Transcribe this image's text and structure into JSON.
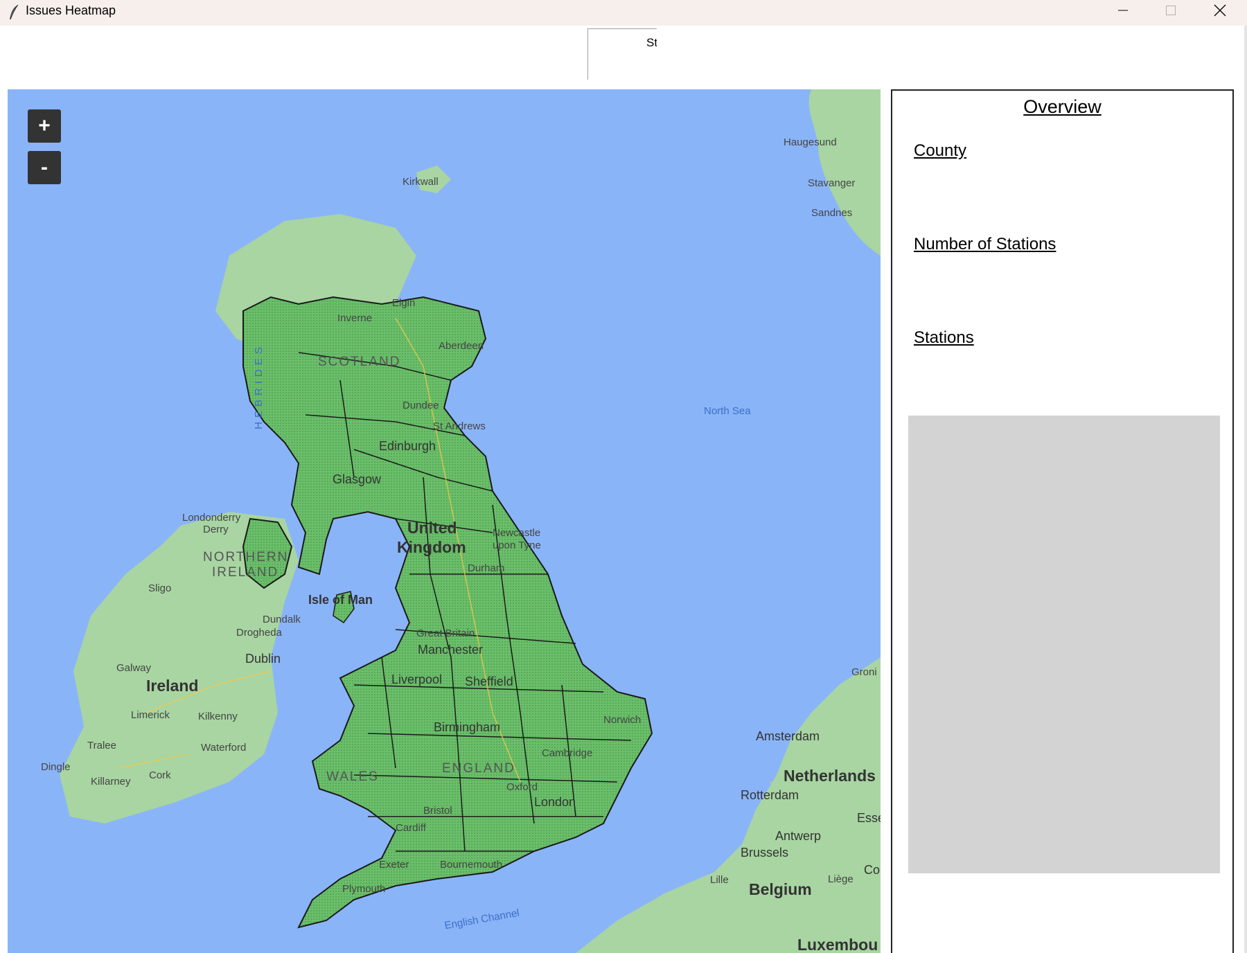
{
  "window": {
    "title": "Issues Heatmap",
    "app_icon": "feather-icon",
    "controls": [
      "minimize-icon",
      "maximize-icon",
      "close-icon"
    ]
  },
  "toolbar": {
    "selector_label": "St"
  },
  "map": {
    "zoom_in_label": "+",
    "zoom_out_label": "-",
    "colors": {
      "water": "#8ab4f8",
      "land": "#a8d5a2",
      "uk_fill": "#6bbf6b",
      "boundary": "#1a1a1a",
      "road": "#f2c84b"
    },
    "labels": {
      "haugesund": "Haugesund",
      "stavanger": "Stavanger",
      "sandnes": "Sandnes",
      "kirkwall": "Kirkwall",
      "elgin": "Elgin",
      "inverness": "Inverne",
      "aberdeen": "Aberdeen",
      "scotland": "SCOTLAND",
      "hebrides": "HEBRIDES",
      "dundee": "Dundee",
      "st_andrews": "St Andrews",
      "edinburgh": "Edinburgh",
      "glasgow": "Glasgow",
      "north_sea": "North Sea",
      "londonderry": "Londonderry",
      "derry": "Derry",
      "northern_ireland_1": "NORTHERN",
      "northern_ireland_2": "IRELAND",
      "united": "United",
      "kingdom": "Kingdom",
      "newcastle_1": "Newcastle",
      "newcastle_2": "upon Tyne",
      "durham": "Durham",
      "sligo": "Sligo",
      "isle_of_man": "Isle of Man",
      "dundalk": "Dundalk",
      "drogheda": "Drogheda",
      "dublin": "Dublin",
      "galway": "Galway",
      "ireland": "Ireland",
      "great_britain": "Great Britain",
      "manchester": "Manchester",
      "liverpool": "Liverpool",
      "sheffield": "Sheffield",
      "limerick": "Limerick",
      "kilkenny": "Kilkenny",
      "groningen": "Groni",
      "norwich": "Norwich",
      "birmingham": "Birmingham",
      "tralee": "Tralee",
      "waterford": "Waterford",
      "cambridge": "Cambridge",
      "amsterdam": "Amsterdam",
      "dingle": "Dingle",
      "killarney": "Killarney",
      "cork": "Cork",
      "wales": "WALES",
      "england": "ENGLAND",
      "oxford": "Oxford",
      "netherlands": "Netherlands",
      "rotterdam": "Rotterdam",
      "london": "London",
      "bristol": "Bristol",
      "essen": "Esse",
      "cardiff": "Cardiff",
      "antwerp": "Antwerp",
      "brussels": "Brussels",
      "exeter": "Exeter",
      "bournemouth": "Bournemouth",
      "cologne": "Co",
      "lille": "Lille",
      "liege": "Liège",
      "belgium": "Belgium",
      "plymouth": "Plymouth",
      "english_channel": "English Channel",
      "luxembourg": "Luxembou"
    }
  },
  "overview": {
    "title": "Overview",
    "county_label": "County",
    "num_stations_label": "Number of Stations",
    "stations_label": "Stations"
  }
}
